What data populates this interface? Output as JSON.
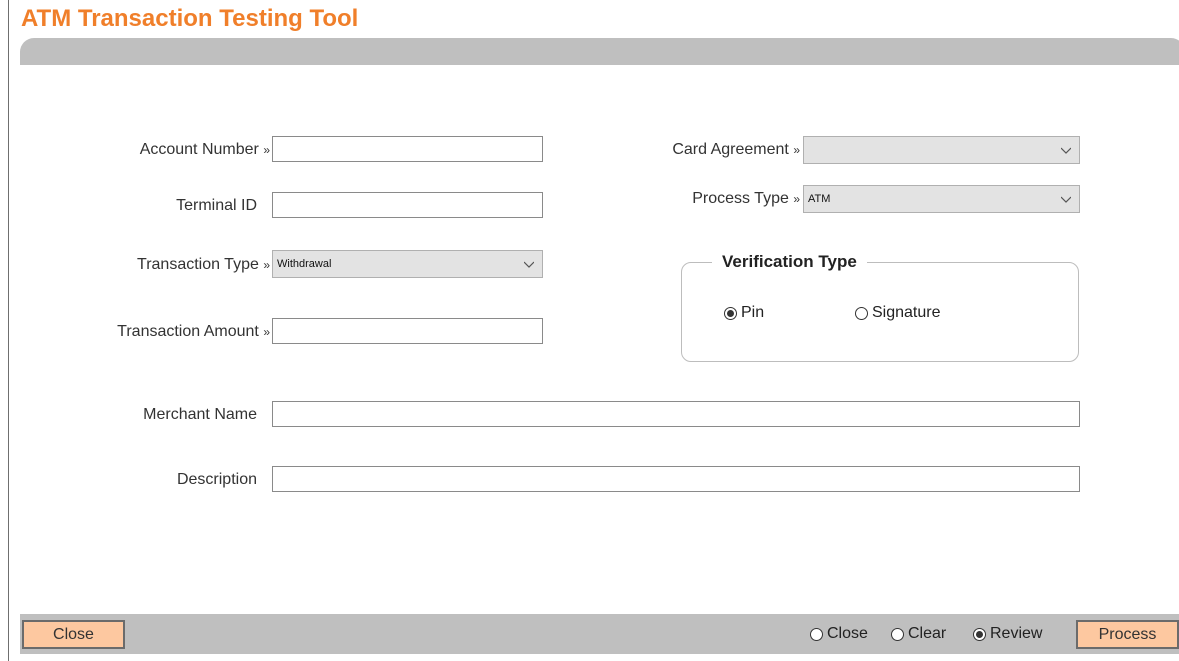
{
  "app": {
    "title": "ATM Transaction Testing Tool"
  },
  "form": {
    "account_number": {
      "label": "Account Number",
      "arrow": "»",
      "value": ""
    },
    "terminal_id": {
      "label": "Terminal ID",
      "value": ""
    },
    "transaction_type": {
      "label": "Transaction Type",
      "arrow": "»",
      "selected": "Withdrawal"
    },
    "transaction_amount": {
      "label": "Transaction Amount",
      "arrow": "»",
      "value": ""
    },
    "card_agreement": {
      "label": "Card Agreement",
      "arrow": "»",
      "selected": ""
    },
    "process_type": {
      "label": "Process Type",
      "arrow": "»",
      "selected": "ATM"
    },
    "merchant_name": {
      "label": "Merchant Name",
      "value": ""
    },
    "description": {
      "label": "Description",
      "value": ""
    }
  },
  "verification": {
    "legend": "Verification Type",
    "options": [
      {
        "label": "Pin",
        "checked": true
      },
      {
        "label": "Signature",
        "checked": false
      }
    ]
  },
  "footer": {
    "close_button": "Close",
    "process_button": "Process",
    "after_action": [
      {
        "label": "Close",
        "checked": false
      },
      {
        "label": "Clear",
        "checked": false
      },
      {
        "label": "Review",
        "checked": true
      }
    ]
  },
  "icons": {
    "dropdown": "chevron-down-icon"
  },
  "colors": {
    "title": "#f07f2a",
    "button_bg": "#fdc8a0",
    "bar": "#bfbfbf"
  }
}
